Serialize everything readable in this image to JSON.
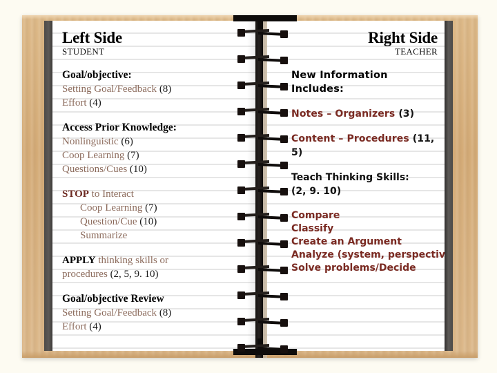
{
  "document": {
    "type": "spiral-notebook",
    "background_color": "#fdfbf2",
    "cover_color": "#d4ab77",
    "paper_color": "#ffffff",
    "rule_color": "#e6e6e6",
    "accent_brown": "#8c6b5c",
    "accent_maroon": "#7a2a22"
  },
  "left_page": {
    "heading": "Left Side",
    "subheading": "STUDENT",
    "sections": [
      {
        "title": "Goal/objective:",
        "items": [
          {
            "text": "Setting Goal/Feedback ",
            "num": "(8)"
          },
          {
            "text": "Effort ",
            "num": "(4)"
          }
        ]
      },
      {
        "title": "Access Prior Knowledge:",
        "items": [
          {
            "text": "Nonlinguistic ",
            "num": "(6)"
          },
          {
            "text": "Coop Learning ",
            "num": "(7)"
          },
          {
            "text": "Questions/Cues ",
            "num": "(10)"
          }
        ]
      },
      {
        "title": "",
        "keyword": "STOP",
        "keyword_style": "maroon",
        "lead": " to Interact",
        "items": [
          {
            "text": "Coop Learning ",
            "num": "(7)",
            "indent": true
          },
          {
            "text": "Question/Cue ",
            "num": "(10)",
            "indent": true
          },
          {
            "text": "Summarize",
            "num": "",
            "indent": true
          }
        ]
      },
      {
        "title": "",
        "keyword": "APPLY",
        "keyword_style": "black",
        "lead": " thinking skills or",
        "items": [
          {
            "text": "procedures ",
            "num": " (2, 5, 9. 10)"
          }
        ]
      },
      {
        "title": "Goal/objective Review",
        "items": [
          {
            "text": "Setting Goal/Feedback ",
            "num": "(8)"
          },
          {
            "text": "Effort ",
            "num": "(4)"
          }
        ]
      }
    ]
  },
  "right_page": {
    "heading": "Right Side",
    "subheading": "TEACHER",
    "intro_line_1": "New Information",
    "intro_line_2": "Includes:",
    "entries": [
      {
        "text": "Notes – Organizers ",
        "num": "(3)"
      },
      {
        "text": "Content – Procedures ",
        "num": "(11, 5)"
      }
    ],
    "thinking_skills_title": "Teach Thinking Skills:",
    "thinking_skills_refs": "(2, 9. 10)",
    "skills": [
      "Compare",
      "Classify",
      "Create an Argument",
      "Analyze (system, perspective)",
      "Solve problems/Decide"
    ]
  }
}
